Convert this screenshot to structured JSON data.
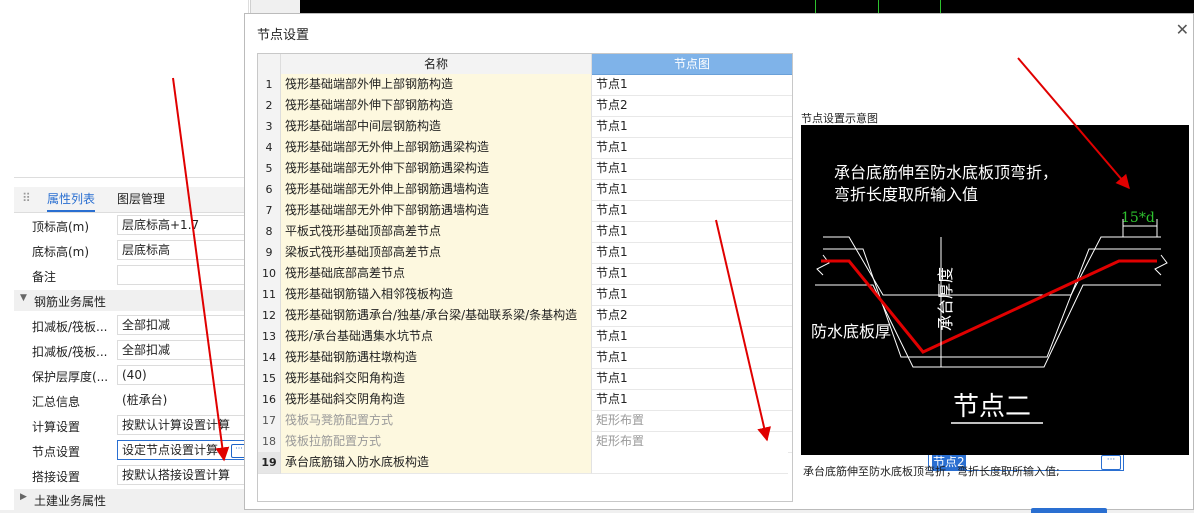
{
  "left_panel": {
    "tabs": [
      "属性列表",
      "图层管理"
    ],
    "properties": [
      {
        "label": "顶标高(m)",
        "value": "层底标高+1.7"
      },
      {
        "label": "底标高(m)",
        "value": "层底标高"
      },
      {
        "label": "备注",
        "value": ""
      }
    ],
    "section_rebar": "钢筋业务属性",
    "rebar_properties": [
      {
        "label": "扣减板/筏板...",
        "value": "全部扣减"
      },
      {
        "label": "扣减板/筏板...",
        "value": "全部扣减"
      },
      {
        "label": "保护层厚度(...",
        "value": "(40)"
      },
      {
        "label": "汇总信息",
        "value": "(桩承台)"
      },
      {
        "label": "计算设置",
        "value": "按默认计算设置计算"
      },
      {
        "label": "节点设置",
        "value": "设定节点设置计算"
      },
      {
        "label": "搭接设置",
        "value": "按默认搭接设置计算"
      }
    ],
    "section_civil": "土建业务属性"
  },
  "dialog": {
    "title": "节点设置",
    "columns": {
      "name": "名称",
      "node": "节点图"
    },
    "rows": [
      {
        "num": "1",
        "name": "筏形基础端部外伸上部钢筋构造",
        "node": "节点1"
      },
      {
        "num": "2",
        "name": "筏形基础端部外伸下部钢筋构造",
        "node": "节点2"
      },
      {
        "num": "3",
        "name": "筏形基础端部中间层钢筋构造",
        "node": "节点1"
      },
      {
        "num": "4",
        "name": "筏形基础端部无外伸上部钢筋遇梁构造",
        "node": "节点1"
      },
      {
        "num": "5",
        "name": "筏形基础端部无外伸下部钢筋遇梁构造",
        "node": "节点1"
      },
      {
        "num": "6",
        "name": "筏形基础端部无外伸上部钢筋遇墙构造",
        "node": "节点1"
      },
      {
        "num": "7",
        "name": "筏形基础端部无外伸下部钢筋遇墙构造",
        "node": "节点1"
      },
      {
        "num": "8",
        "name": "平板式筏形基础顶部高差节点",
        "node": "节点1"
      },
      {
        "num": "9",
        "name": "梁板式筏形基础顶部高差节点",
        "node": "节点1"
      },
      {
        "num": "10",
        "name": "筏形基础底部高差节点",
        "node": "节点1"
      },
      {
        "num": "11",
        "name": "筏形基础钢筋锚入相邻筏板构造",
        "node": "节点1"
      },
      {
        "num": "12",
        "name": "筏形基础钢筋遇承台/独基/承台梁/基础联系梁/条基构造",
        "node": "节点2"
      },
      {
        "num": "13",
        "name": "筏形/承台基础遇集水坑节点",
        "node": "节点1"
      },
      {
        "num": "14",
        "name": "筏形基础钢筋遇柱墩构造",
        "node": "节点1"
      },
      {
        "num": "15",
        "name": "筏形基础斜交阳角构造",
        "node": "节点1"
      },
      {
        "num": "16",
        "name": "筏形基础斜交阴角构造",
        "node": "节点1"
      },
      {
        "num": "17",
        "name": "筏板马凳筋配置方式",
        "node": "矩形布置"
      },
      {
        "num": "18",
        "name": "筏板拉筋配置方式",
        "node": "矩形布置"
      },
      {
        "num": "19",
        "name": "承台底筋锚入防水底板构造",
        "node": "节点2"
      }
    ],
    "preview_title": "节点设置示意图",
    "preview": {
      "caption_line1": "承台底筋伸至防水底板顶弯折，",
      "caption_line2": "弯折长度取所输入值",
      "dim_label": "15*d",
      "label_thickness": "承台厚度",
      "label_waterproof": "防水底板厚",
      "node_title": "节点二"
    },
    "preview_desc": "承台底筋伸至防水底板顶弯折，弯折长度取所输入值;",
    "colors": {
      "header_blue": "#7fb3e9",
      "name_cell": "#fdf8df",
      "accent": "#2a6fd1",
      "annotation_red": "#e00000",
      "dim_green": "#2ec12e"
    }
  }
}
